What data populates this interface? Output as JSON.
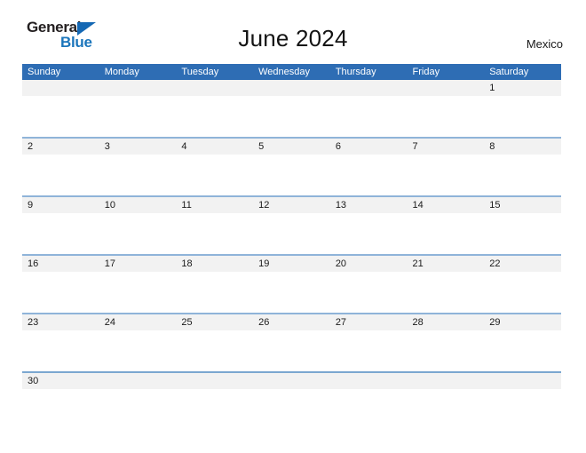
{
  "brand": {
    "name_part1": "General",
    "name_part2": "Blue",
    "triangle_color": "#1468b4",
    "text_color_primary": "#231f20",
    "text_color_secondary": "#1b75bb"
  },
  "header": {
    "title": "June 2024",
    "region": "Mexico"
  },
  "theme": {
    "header_blue": "#2e6db4",
    "row_rule_blue": "#8fb4d9",
    "date_band_gray": "#f2f2f2",
    "page_background": "#ffffff",
    "text_color": "#1a1a1a"
  },
  "calendar": {
    "month": "June",
    "year": "2024",
    "weekday_labels": [
      "Sunday",
      "Monday",
      "Tuesday",
      "Wednesday",
      "Thursday",
      "Friday",
      "Saturday"
    ],
    "weeks": [
      [
        "",
        "",
        "",
        "",
        "",
        "",
        "1"
      ],
      [
        "2",
        "3",
        "4",
        "5",
        "6",
        "7",
        "8"
      ],
      [
        "9",
        "10",
        "11",
        "12",
        "13",
        "14",
        "15"
      ],
      [
        "16",
        "17",
        "18",
        "19",
        "20",
        "21",
        "22"
      ],
      [
        "23",
        "24",
        "25",
        "26",
        "27",
        "28",
        "29"
      ],
      [
        "30",
        "",
        "",
        "",
        "",
        "",
        ""
      ]
    ]
  }
}
